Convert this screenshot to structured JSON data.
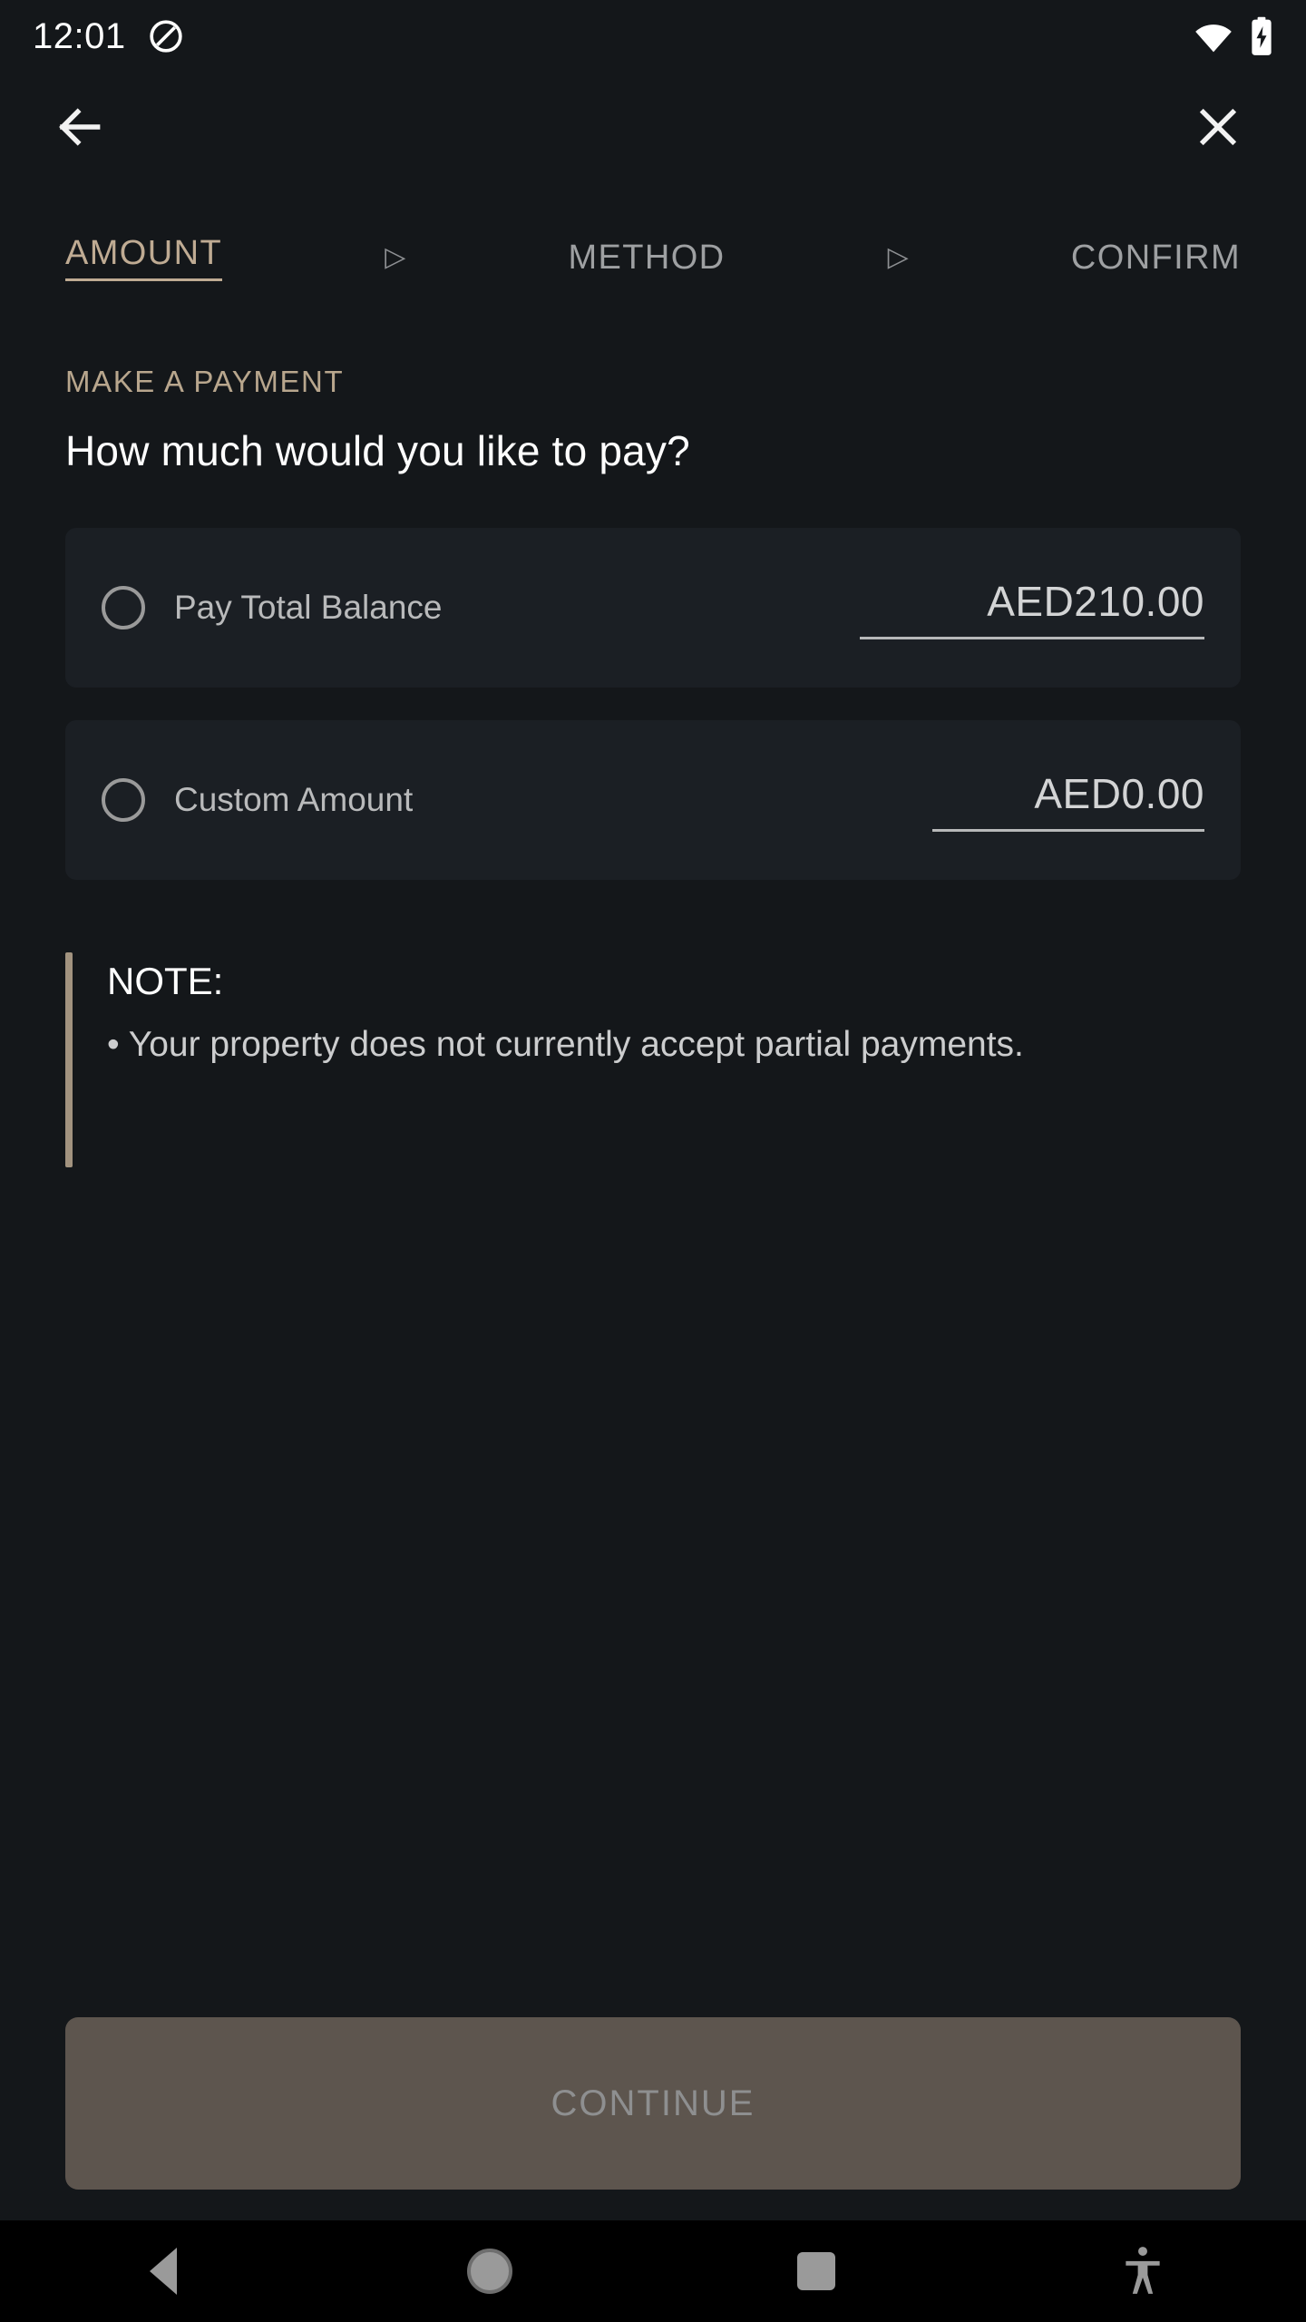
{
  "status_bar": {
    "time": "12:01",
    "icons": [
      "dnd-icon",
      "wifi-icon",
      "battery-charging-icon"
    ]
  },
  "app_bar": {
    "back_icon": "arrow-back-icon",
    "close_icon": "close-icon"
  },
  "stepper": {
    "separator": "▷",
    "steps": [
      {
        "label": "AMOUNT",
        "active": true
      },
      {
        "label": "METHOD",
        "active": false
      },
      {
        "label": "CONFIRM",
        "active": false
      }
    ]
  },
  "main": {
    "eyebrow": "MAKE A PAYMENT",
    "headline": "How much would you like to pay?",
    "options": [
      {
        "label": "Pay Total Balance",
        "amount": "AED210.00",
        "selected": false
      },
      {
        "label": "Custom Amount",
        "amount": "AED0.00",
        "selected": false
      }
    ],
    "note": {
      "title": "NOTE:",
      "text": "• Your property does not currently accept partial payments."
    }
  },
  "footer": {
    "continue_label": "CONTINUE",
    "continue_enabled": false
  },
  "nav_bar": {
    "back": "nav-back-icon",
    "home": "nav-home-icon",
    "recents": "nav-recents-icon",
    "accessibility": "accessibility-icon"
  },
  "colors": {
    "page_bg": "#14171a",
    "card_bg": "#1b1f24",
    "accent_tan": "#bfab93",
    "note_bar": "#a2937f",
    "disabled_button_bg": "#5d554e",
    "disabled_button_text": "#8e8f90"
  }
}
